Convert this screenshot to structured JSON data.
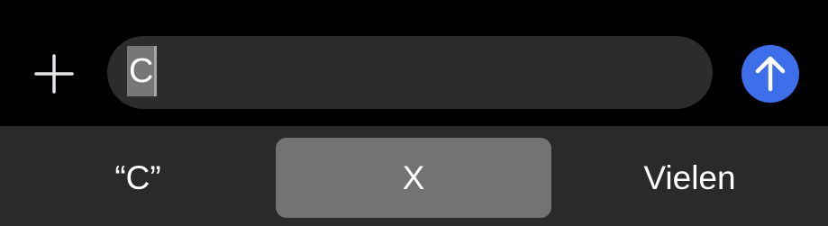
{
  "composer": {
    "plus_icon": "plus-icon",
    "input_text": "C",
    "send_icon": "arrow-up-icon",
    "accent_color": "#3e6eea"
  },
  "suggestions": {
    "items": [
      {
        "label": "“C”"
      },
      {
        "label": "X",
        "highlighted": true
      },
      {
        "label": "Vielen"
      }
    ]
  }
}
